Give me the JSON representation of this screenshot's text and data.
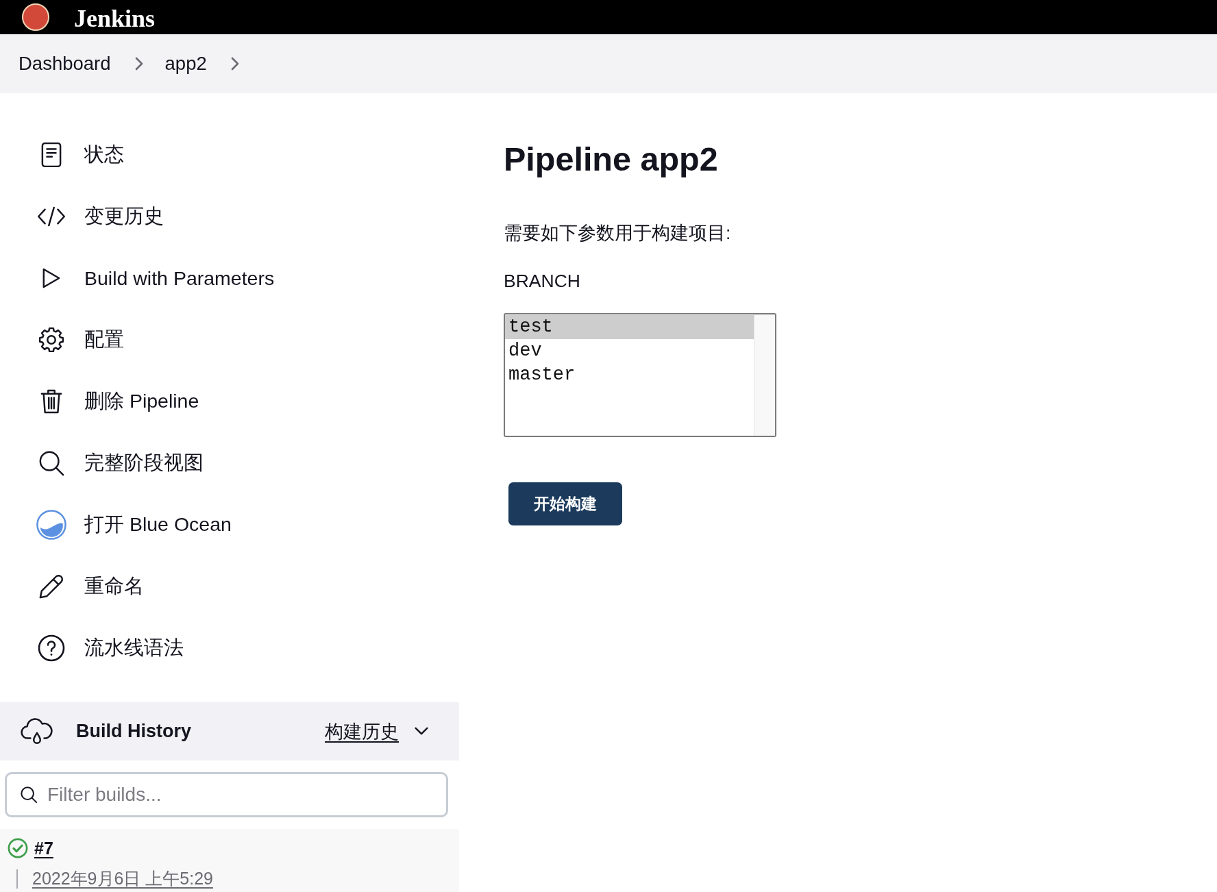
{
  "header": {
    "logo_text": "Jenkins"
  },
  "breadcrumbs": [
    {
      "label": "Dashboard"
    },
    {
      "label": "app2"
    }
  ],
  "sidebar": {
    "items": [
      {
        "label": "状态"
      },
      {
        "label": "变更历史"
      },
      {
        "label": "Build with Parameters"
      },
      {
        "label": "配置"
      },
      {
        "label": "删除 Pipeline"
      },
      {
        "label": "完整阶段视图"
      },
      {
        "label": "打开 Blue Ocean"
      },
      {
        "label": "重命名"
      },
      {
        "label": "流水线语法"
      }
    ]
  },
  "build_history": {
    "title": "Build History",
    "link": "构建历史",
    "filter": {
      "placeholder": "Filter builds..."
    },
    "builds": [
      {
        "number": "#7",
        "successful": true,
        "date": "2022年9月6日 上午5:29"
      }
    ]
  },
  "main": {
    "title": "Pipeline app2",
    "description": "需要如下参数用于构建项目:",
    "parameters": [
      {
        "name": "BRANCH",
        "options": [
          {
            "label": "test",
            "selected": true
          },
          {
            "label": "dev",
            "selected": false
          },
          {
            "label": "master",
            "selected": false
          }
        ]
      }
    ],
    "submit_button": "开始构建"
  }
}
